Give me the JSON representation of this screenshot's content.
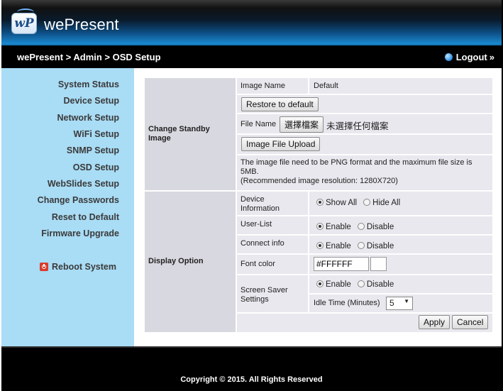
{
  "brand": {
    "name": "wePresent",
    "badge": "wP"
  },
  "nav": {
    "breadcrumb": "wePresent > Admin > OSD Setup",
    "logout_label": "Logout",
    "logout_chevron": "»"
  },
  "sidebar": {
    "items": [
      {
        "label": "System Status"
      },
      {
        "label": "Device Setup"
      },
      {
        "label": "Network Setup"
      },
      {
        "label": "WiFi Setup"
      },
      {
        "label": "SNMP Setup"
      },
      {
        "label": "OSD Setup"
      },
      {
        "label": "WebSlides Setup"
      },
      {
        "label": "Change Passwords"
      },
      {
        "label": "Reset to Default"
      },
      {
        "label": "Firmware Upgrade"
      }
    ],
    "reboot_label": "Reboot System"
  },
  "standby": {
    "section_title": "Change Standby Image",
    "image_name_label": "Image Name",
    "image_name_value": "Default",
    "restore_button": "Restore to default",
    "file_name_label": "File Name",
    "choose_file_button": "選擇檔案",
    "no_file_text": "未選擇任何檔案",
    "upload_button": "Image File Upload",
    "note_line1": "The image file need to be PNG format and the maximum file size is",
    "note_line2": "5MB.",
    "note_line3": "(Recommended image resolution: 1280X720)"
  },
  "display": {
    "section_title": "Display Option",
    "device_info": {
      "label_line1": "Device",
      "label_line2": "Information",
      "option_a": "Show All",
      "option_b": "Hide All",
      "selected": "Show All"
    },
    "user_list": {
      "label": "User-List",
      "option_a": "Enable",
      "option_b": "Disable",
      "selected": "Enable"
    },
    "connect_info": {
      "label": "Connect info",
      "option_a": "Enable",
      "option_b": "Disable",
      "selected": "Enable"
    },
    "font_color": {
      "label": "Font color",
      "value": "#FFFFFF",
      "swatch": "#FFFFFF"
    },
    "screen_saver": {
      "label_line1": "Screen Saver",
      "label_line2": "Settings",
      "option_a": "Enable",
      "option_b": "Disable",
      "selected": "Enable",
      "idle_label": "Idle Time (Minutes)",
      "idle_value": "5"
    }
  },
  "actions": {
    "apply": "Apply",
    "cancel": "Cancel"
  },
  "footer": {
    "copyright": "Copyright © 2015. All Rights Reserved"
  },
  "colors": {
    "sidebar_bg": "#a9dcf5",
    "header_accent": "#1a8ad0",
    "cell_bg": "#e8e8ee"
  },
  "icons": {
    "logout": "globe-dot-icon",
    "reboot": "power-icon",
    "select": "chevron-down-icon"
  }
}
